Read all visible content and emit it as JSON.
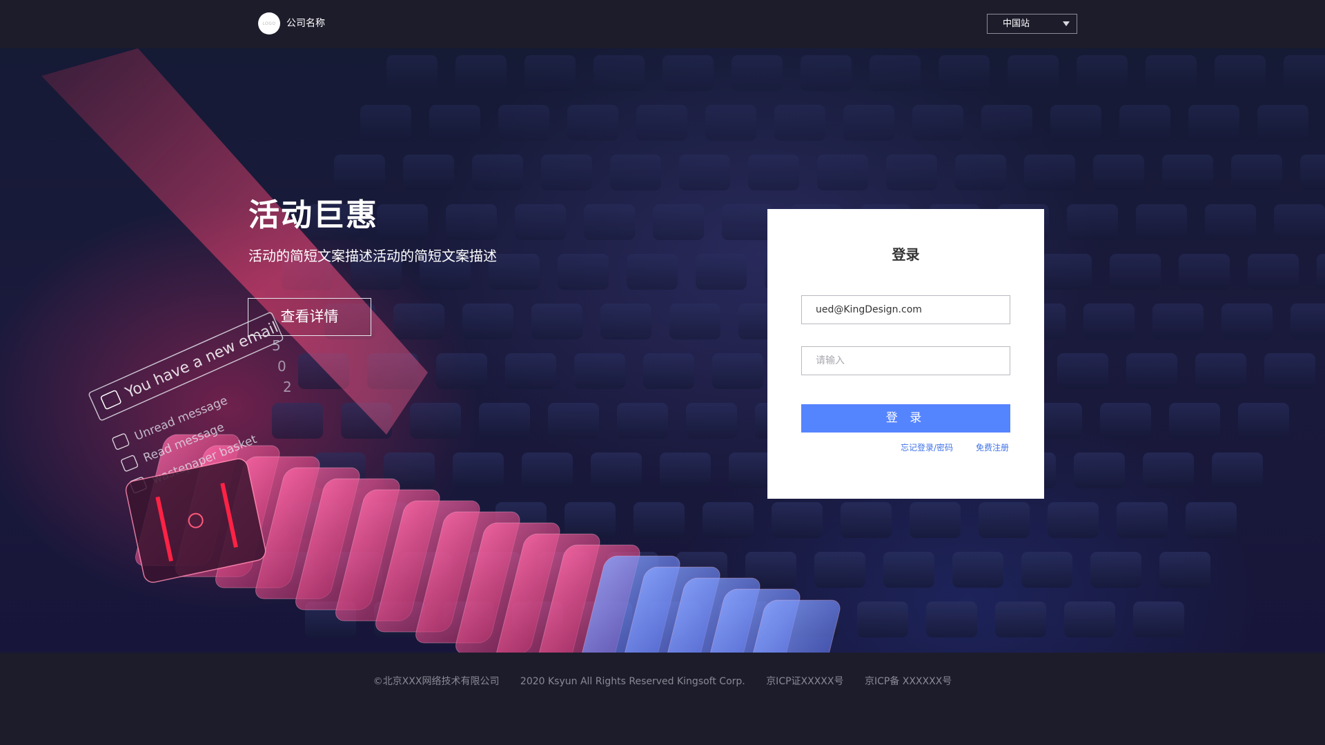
{
  "header": {
    "logo_text": "LOGO",
    "company_name": "公司名称",
    "site_select": "中国站"
  },
  "hero": {
    "title": "活动巨惠",
    "description": "活动的简短文案描述活动的简短文案描述",
    "detail_button": "查看详情",
    "art_text": {
      "new_email": "You have a new email",
      "unread": "Unread message",
      "read": "Read message",
      "wastepaper": "wastepaper basket",
      "digits": [
        "5",
        "0",
        "2"
      ]
    }
  },
  "login": {
    "title": "登录",
    "email_value": "ued@KingDesign.com",
    "password_placeholder": "请输入",
    "submit_label": "登 录",
    "forgot_link": "忘记登录/密码",
    "register_link": "免费注册"
  },
  "footer": {
    "company": "©北京XXX网络技术有限公司",
    "rights": "2020 Ksyun All Rights Reserved Kingsoft Corp.",
    "icp_license": "京ICP证XXXXX号",
    "icp_record": "京ICP备 XXXXXX号"
  },
  "colors": {
    "primary_button": "#5584ff",
    "link": "#3f72e9",
    "header_bg": "#1d1c2b"
  }
}
